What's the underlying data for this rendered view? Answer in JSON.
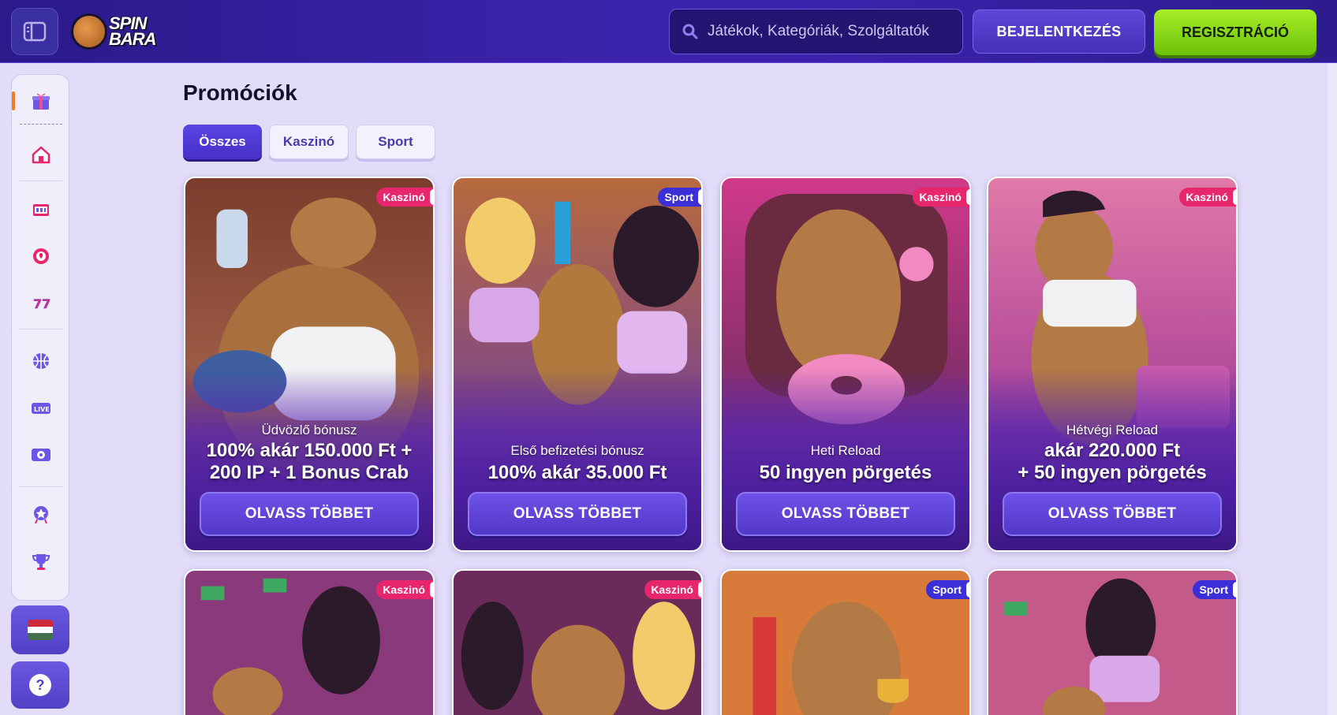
{
  "header": {
    "logo_text_line1": "SPIN",
    "logo_text_line2": "BARA",
    "search_placeholder": "Játékok, Kategóriák, Szolgáltatók",
    "login_label": "BEJELENTKEZÉS",
    "register_label": "REGISZTRÁCIÓ"
  },
  "sidebar": {
    "items": [
      {
        "icon": "gift-icon",
        "active": true
      },
      {
        "icon": "home-icon"
      },
      {
        "icon": "dice-icon"
      },
      {
        "icon": "poker-chip-icon"
      },
      {
        "icon": "slot-777-icon"
      },
      {
        "icon": "basketball-icon"
      },
      {
        "icon": "live-icon"
      },
      {
        "icon": "virtual-sports-icon"
      },
      {
        "icon": "vip-icon"
      },
      {
        "icon": "trophy-icon"
      }
    ],
    "language": "hu-flag-icon",
    "help_label": "?"
  },
  "main": {
    "title": "Promóciók",
    "filters": [
      "Összes",
      "Kaszinó",
      "Sport"
    ],
    "cards": [
      {
        "badge": "Kaszinó",
        "subtitle": "Üdvözlő bónusz",
        "title_line1": "100% akár 150.000 Ft +",
        "title_line2": "200 IP + 1 Bonus Crab",
        "button": "OLVASS TÖBBET"
      },
      {
        "badge": "Sport",
        "subtitle": "Első befizetési bónusz",
        "title_line1": "100% akár 35.000 Ft",
        "title_line2": "",
        "button": "OLVASS TÖBBET"
      },
      {
        "badge": "Kaszinó",
        "subtitle": "Heti Reload",
        "title_line1": "50 ingyen pörgetés",
        "title_line2": "",
        "button": "OLVASS TÖBBET"
      },
      {
        "badge": "Kaszinó",
        "subtitle": "Hétvégi Reload",
        "title_line1": "akár 220.000 Ft",
        "title_line2": "+ 50 ingyen pörgetés",
        "button": "OLVASS TÖBBET"
      },
      {
        "badge": "Kaszinó"
      },
      {
        "badge": "Kaszinó"
      },
      {
        "badge": "Sport"
      },
      {
        "badge": "Sport"
      }
    ]
  },
  "colors": {
    "header_bg": "#3a22a8",
    "register_green": "#8ad81a",
    "casino_badge": "#e8266c",
    "sport_badge": "#3b2fd8",
    "active_indicator": "#f47a1f"
  }
}
